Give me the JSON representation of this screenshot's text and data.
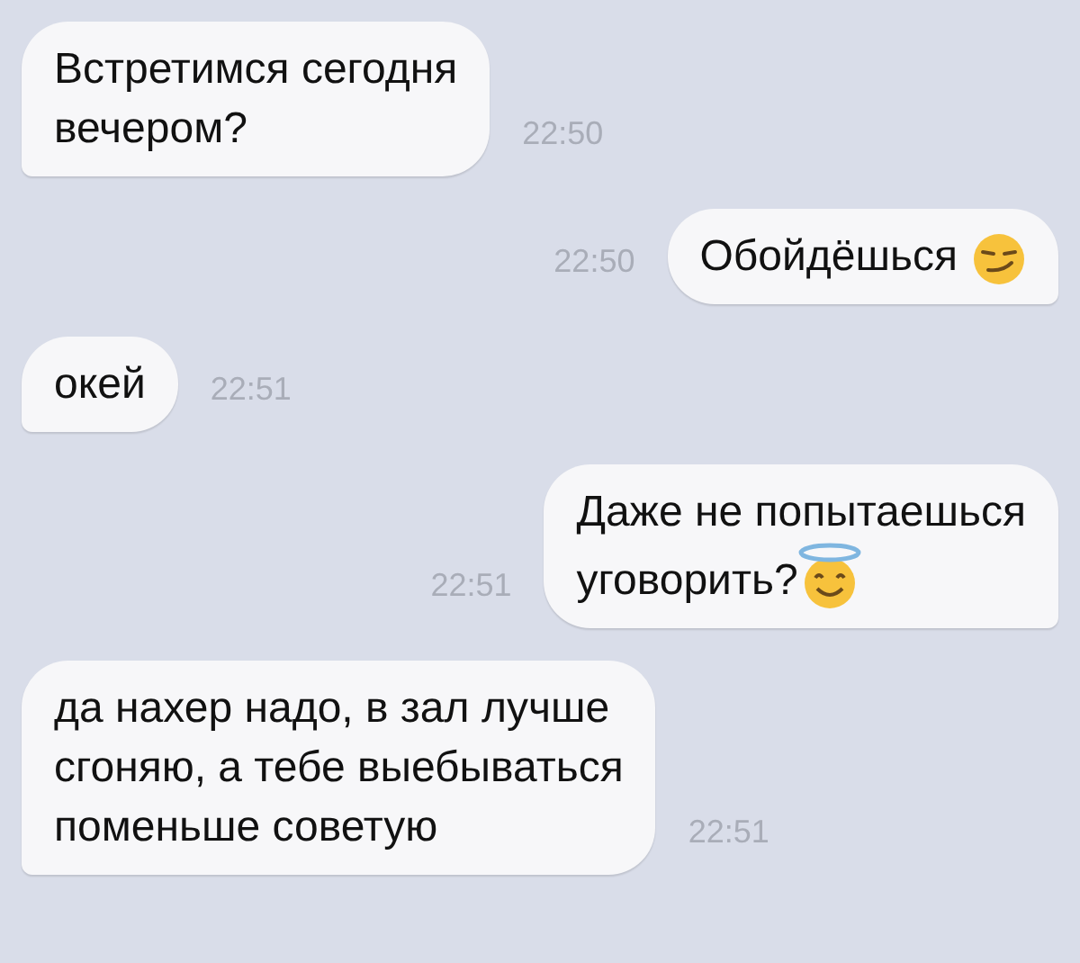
{
  "messages": [
    {
      "kind": "incoming",
      "text": "Встретимся сегодня\nвечером?",
      "time": "22:50"
    },
    {
      "kind": "outgoing",
      "text": "Обойдёшься",
      "emoji": {
        "kind": "smirk"
      },
      "time": "22:50"
    },
    {
      "kind": "incoming",
      "text": "окей",
      "time": "22:51"
    },
    {
      "kind": "outgoing",
      "text": "Даже не попытаешься\nуговорить?",
      "emoji": {
        "kind": "angel"
      },
      "time": "22:51"
    },
    {
      "kind": "incoming",
      "text": "да нахер надо, в зал лучше\nсгоняю, а тебе выебываться\nпоменьше советую",
      "time": "22:51"
    }
  ]
}
